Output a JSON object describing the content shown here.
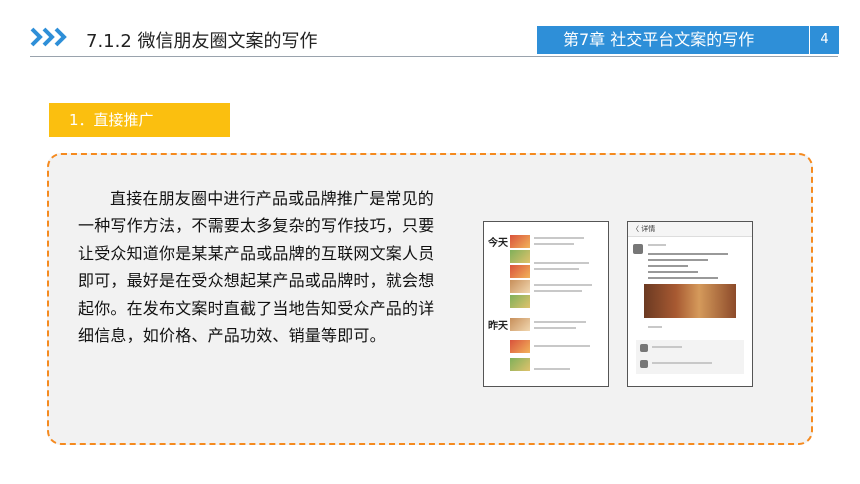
{
  "header": {
    "section_title": "7.1.2  微信朋友圈文案的写作",
    "chapter_title": "第7章   社交平台文案的写作",
    "page_number": "4"
  },
  "section_label": "1．直接推广",
  "body_text": "直接在朋友圈中进行产品或品牌推广是常见的一种写作方法，不需要太多复杂的写作技巧，只要让受众知道你是某某产品或品牌的互联网文案人员即可，最好是在受众想起某产品或品牌时，就会想起你。在发布文案时直截了当地告知受众产品的详细信息，如价格、产品功效、销量等即可。",
  "screenshots": {
    "left": {
      "today_label": "今天",
      "yesterday_label": "昨天"
    },
    "right": {
      "back_label": "〈 详情"
    }
  },
  "colors": {
    "accent_blue": "#2e8fd8",
    "label_yellow": "#fbbf0f",
    "dashed_orange": "#f58a1f",
    "content_bg": "#f2f2f2"
  }
}
